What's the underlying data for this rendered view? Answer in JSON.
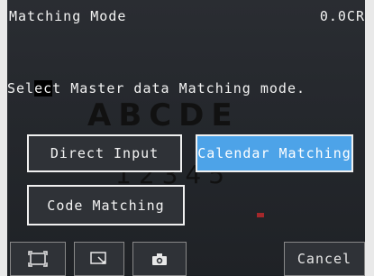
{
  "header": {
    "title": "Matching Mode",
    "value": "0.0CR"
  },
  "instruction": {
    "prefix": "Sel",
    "cursor_text": "ec",
    "suffix": "t Master data Matching mode."
  },
  "background_image_text": {
    "letters": "ABCDE",
    "numbers": "12345"
  },
  "mode_buttons": {
    "direct_input": "Direct Input",
    "calendar_matching": "Calendar Matching",
    "code_matching": "Code Matching",
    "selected": "Calendar Matching"
  },
  "toolbar": {
    "frame_icon": "frame-icon",
    "zoom_icon": "zoom-region-icon",
    "camera_icon": "camera-icon",
    "cancel_label": "Cancel"
  },
  "colors": {
    "selected_button": "#4da3e8",
    "accent_red": "#a3282b"
  }
}
